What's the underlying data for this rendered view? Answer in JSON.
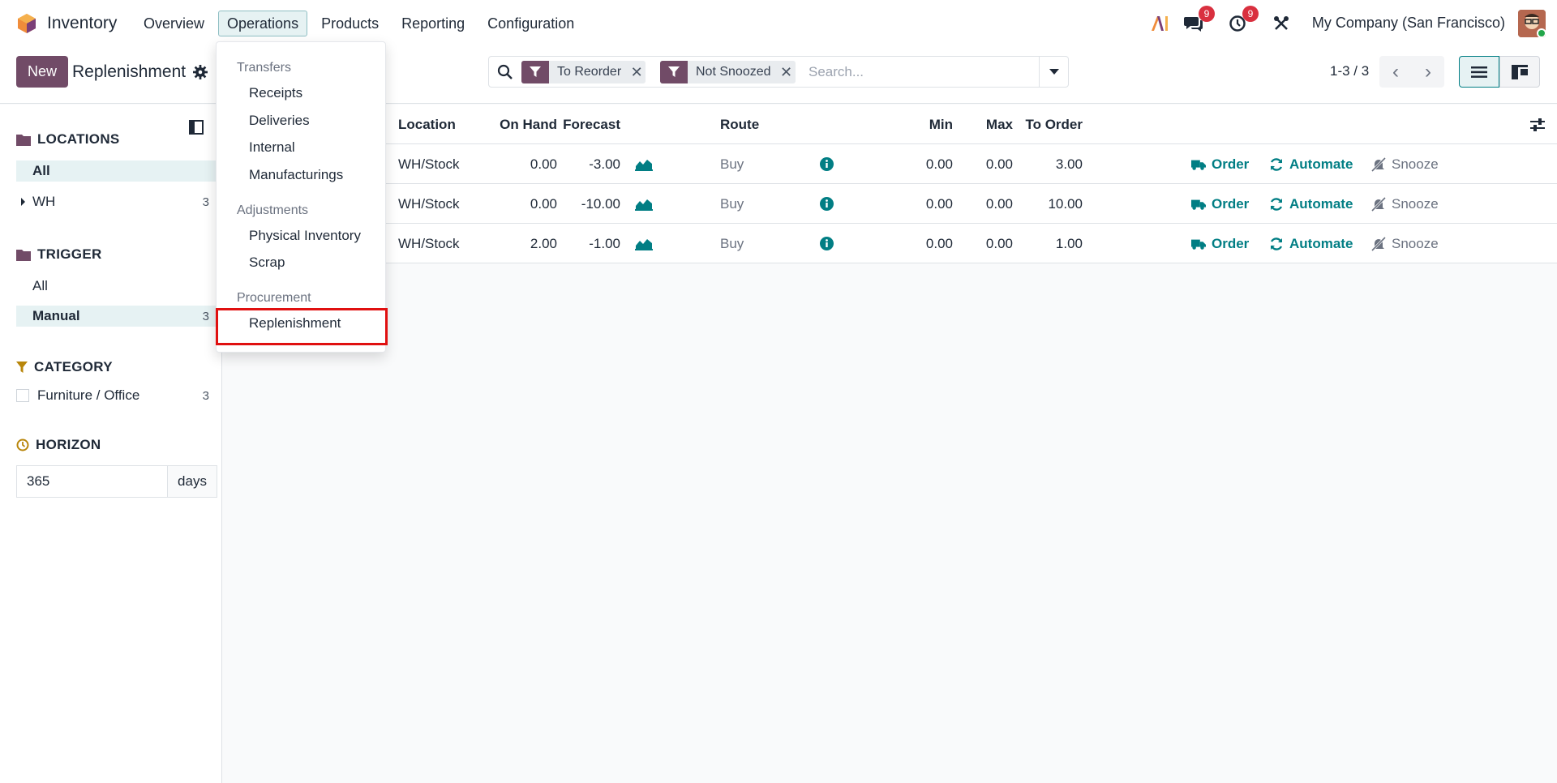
{
  "navbar": {
    "app_name": "Inventory",
    "menu": [
      "Overview",
      "Operations",
      "Products",
      "Reporting",
      "Configuration"
    ],
    "active_menu": "Operations",
    "messages_badge": "9",
    "activities_badge": "9",
    "company": "My Company (San Francisco)"
  },
  "control": {
    "new_label": "New",
    "title": "Replenishment",
    "facets": [
      "To Reorder",
      "Not Snoozed"
    ],
    "search_placeholder": "Search...",
    "pager": "1-3 / 3"
  },
  "operations_menu": {
    "sections": [
      {
        "title": "Transfers",
        "items": [
          "Receipts",
          "Deliveries",
          "Internal",
          "Manufacturings"
        ]
      },
      {
        "title": "Adjustments",
        "items": [
          "Physical Inventory",
          "Scrap"
        ]
      },
      {
        "title": "Procurement",
        "items": [
          "Replenishment"
        ]
      }
    ]
  },
  "sidepanel": {
    "locations": {
      "title": "LOCATIONS",
      "all": "All",
      "wh": "WH",
      "wh_count": "3"
    },
    "trigger": {
      "title": "TRIGGER",
      "all": "All",
      "manual": "Manual",
      "manual_count": "3"
    },
    "category": {
      "title": "CATEGORY",
      "item": "Furniture / Office",
      "count": "3"
    },
    "horizon": {
      "title": "HORIZON",
      "value": "365",
      "unit": "days"
    }
  },
  "list": {
    "columns": {
      "location": "Location",
      "on_hand": "On Hand",
      "forecast": "Forecast",
      "route": "Route",
      "min": "Min",
      "max": "Max",
      "to_order": "To Order"
    },
    "rows": [
      {
        "location": "WH/Stock",
        "on_hand": "0.00",
        "forecast": "-3.00",
        "route": "Buy",
        "min": "0.00",
        "max": "0.00",
        "to_order": "3.00"
      },
      {
        "location": "WH/Stock",
        "on_hand": "0.00",
        "forecast": "-10.00",
        "route": "Buy",
        "min": "0.00",
        "max": "0.00",
        "to_order": "10.00"
      },
      {
        "location": "WH/Stock",
        "on_hand": "2.00",
        "forecast": "-1.00",
        "route": "Buy",
        "min": "0.00",
        "max": "0.00",
        "to_order": "1.00"
      }
    ],
    "actions": {
      "order": "Order",
      "automate": "Automate",
      "snooze": "Snooze"
    }
  },
  "colors": {
    "brand": "#714b67",
    "accent": "#017e84",
    "badge": "#d9303f",
    "highlight": "#e01010"
  },
  "icons": [
    "search-icon",
    "filter-icon",
    "gear-icon",
    "chart-icon",
    "info-icon",
    "truck-icon",
    "refresh-icon",
    "bell-slash-icon",
    "chat-icon",
    "clock-icon",
    "tools-icon"
  ]
}
